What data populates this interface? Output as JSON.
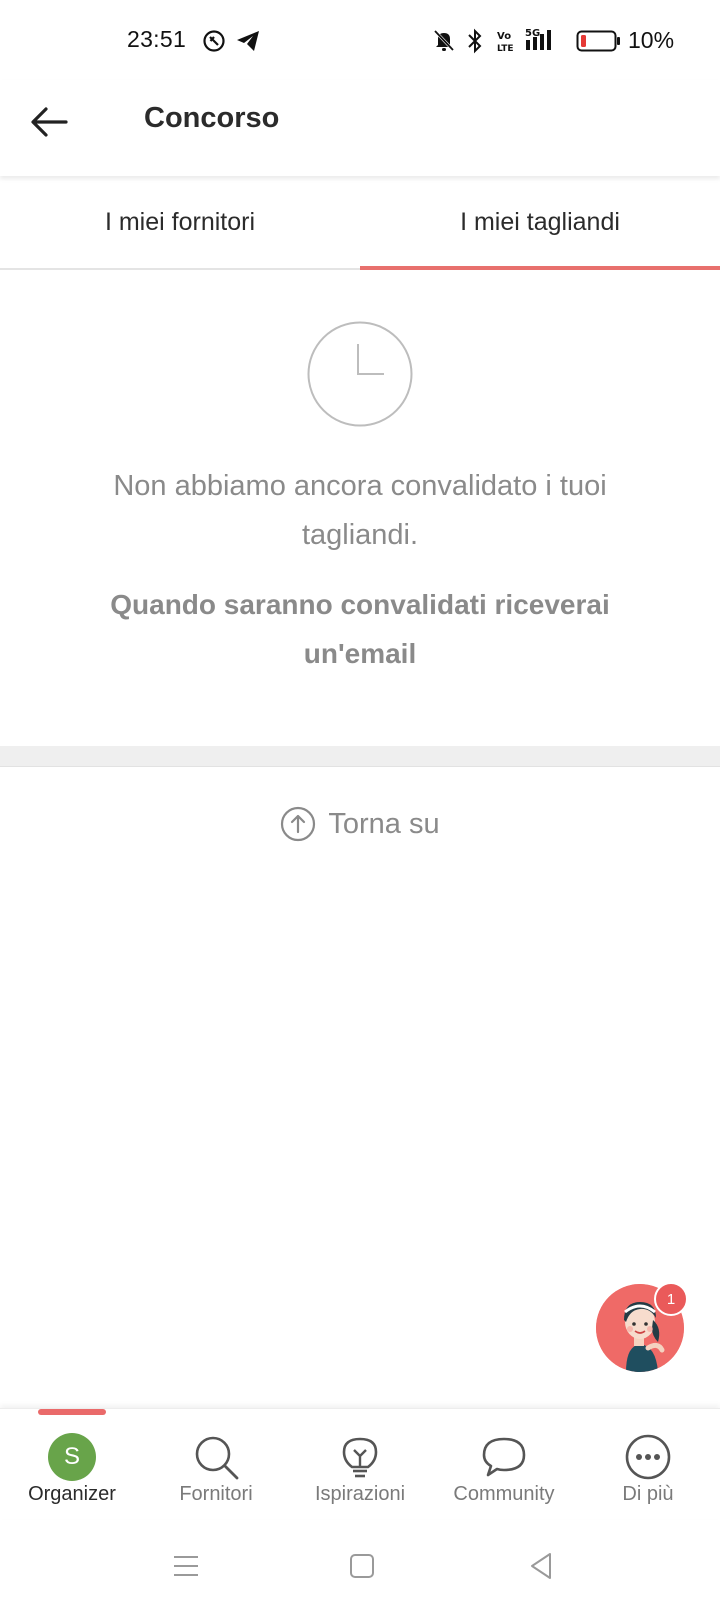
{
  "status_bar": {
    "time": "23:51",
    "battery": "10%",
    "icons": [
      "whatsapp-icon",
      "telegram-icon",
      "mute-icon",
      "bluetooth-icon",
      "volte-icon",
      "signal-5g-icon",
      "battery-icon"
    ]
  },
  "header": {
    "title": "Concorso"
  },
  "tabs": [
    {
      "label": "I miei fornitori",
      "active": false
    },
    {
      "label": "I miei tagliandi",
      "active": true
    }
  ],
  "empty_state": {
    "icon": "clock-icon",
    "message": "Non abbiamo ancora convalidato i tuoi tagliandi.",
    "note": "Quando saranno convalidati riceverai un'email"
  },
  "back_to_top": {
    "label": "Torna su"
  },
  "assistant": {
    "badge": "1"
  },
  "bottom_nav": {
    "items": [
      {
        "label": "Organizer",
        "icon": "avatar",
        "avatar_letter": "S",
        "active": true
      },
      {
        "label": "Fornitori",
        "icon": "search-icon",
        "active": false
      },
      {
        "label": "Ispirazioni",
        "icon": "lightbulb-icon",
        "active": false
      },
      {
        "label": "Community",
        "icon": "chat-bubble-icon",
        "active": false
      },
      {
        "label": "Di più",
        "icon": "more-icon",
        "active": false
      }
    ]
  },
  "colors": {
    "accent": "#e8706d",
    "avatar": "#68a44a",
    "muted_text": "#8a8a8a"
  }
}
